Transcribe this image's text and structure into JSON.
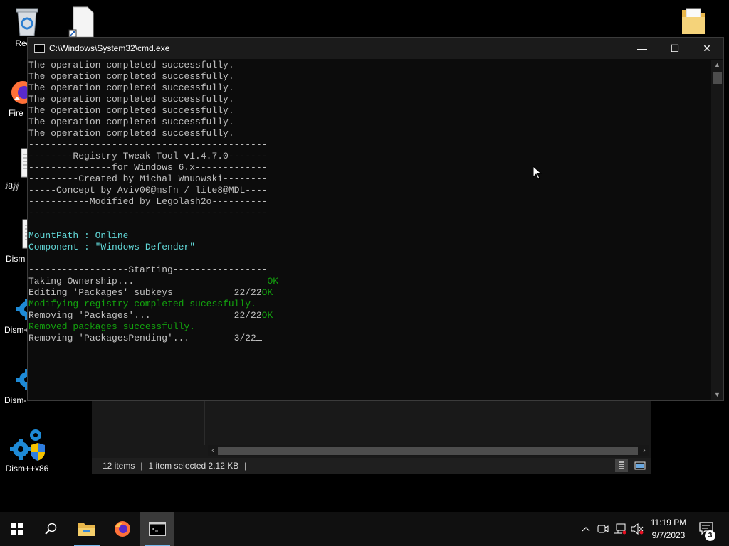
{
  "desktop": {
    "icons": [
      {
        "label": "Recyc",
        "icon": "recycle-bin-icon"
      },
      {
        "label": "",
        "icon": "file-shortcut-icon"
      },
      {
        "label": "",
        "icon": "folder-icon"
      },
      {
        "label": "Fire",
        "icon": "firefox-icon"
      },
      {
        "label": "ⅈ8ⅉⅉ",
        "icon": "text-file-icon"
      },
      {
        "label": "Dism",
        "icon": "text-file-icon"
      },
      {
        "label": "Dism+",
        "icon": "gear-icon"
      },
      {
        "label": "Dism-",
        "icon": "gear-icon"
      },
      {
        "label": "Dism++x86",
        "icon": "dism-shield-icon"
      }
    ]
  },
  "cmd_window": {
    "title": "C:\\Windows\\System32\\cmd.exe",
    "minimize_glyph": "—",
    "maximize_glyph": "☐",
    "close_glyph": "✕",
    "lines": [
      {
        "text": "The operation completed successfully.",
        "color": "default"
      },
      {
        "text": "The operation completed successfully.",
        "color": "default"
      },
      {
        "text": "The operation completed successfully.",
        "color": "default"
      },
      {
        "text": "The operation completed successfully.",
        "color": "default"
      },
      {
        "text": "The operation completed successfully.",
        "color": "default"
      },
      {
        "text": "The operation completed successfully.",
        "color": "default"
      },
      {
        "text": "The operation completed successfully.",
        "color": "default"
      },
      {
        "text": "-------------------------------------------",
        "color": "default"
      },
      {
        "text": "--------Registry Tweak Tool v1.4.7.0-------",
        "color": "default"
      },
      {
        "text": "---------------for Windows 6.x-------------",
        "color": "default"
      },
      {
        "text": "---------Created by Michal Wnuowski--------",
        "color": "default"
      },
      {
        "text": "-----Concept by Aviv00@msfn / lite8@MDL----",
        "color": "default"
      },
      {
        "text": "-----------Modified by Legolash2o----------",
        "color": "default"
      },
      {
        "text": "-------------------------------------------",
        "color": "default"
      },
      {
        "text": "",
        "color": "default"
      },
      {
        "text": "MountPath : Online",
        "color": "cyan"
      },
      {
        "text": "Component : \"Windows-Defender\"",
        "color": "cyan"
      },
      {
        "text": "",
        "color": "default"
      },
      {
        "text": "------------------Starting-----------------",
        "color": "default"
      },
      {
        "text": "Taking Ownership...",
        "color": "default",
        "status": "OK",
        "status_pad": "                        "
      },
      {
        "text": "Editing 'Packages' subkeys           22/22",
        "color": "default",
        "status": "OK",
        "status_pad": ""
      },
      {
        "text": "Modifying registry completed sucessfully.",
        "color": "green"
      },
      {
        "text": "Removing 'Packages'...               22/22",
        "color": "default",
        "status": "OK",
        "status_pad": ""
      },
      {
        "text": "Removed packages successfully.",
        "color": "green"
      },
      {
        "text": "Removing 'PackagesPending'...        3/22",
        "color": "default",
        "cursor": true
      }
    ]
  },
  "explorer": {
    "items_count": "12 items",
    "selection": "1 item selected  2.12 KB",
    "separator": "|"
  },
  "taskbar": {
    "start_icon": "windows-start-icon",
    "search_icon": "search-icon",
    "pinned": [
      "file-explorer-icon",
      "firefox-icon",
      "cmd-icon"
    ],
    "tray": {
      "chevron": "^",
      "time": "11:19 PM",
      "date": "9/7/2023",
      "notification_count": "3"
    }
  },
  "colors": {
    "console_bg": "#0c0c0c",
    "console_text": "#c0c0c0",
    "console_cyan": "#61d6d6",
    "console_green": "#13a10e",
    "taskbar_bg": "#101010"
  }
}
